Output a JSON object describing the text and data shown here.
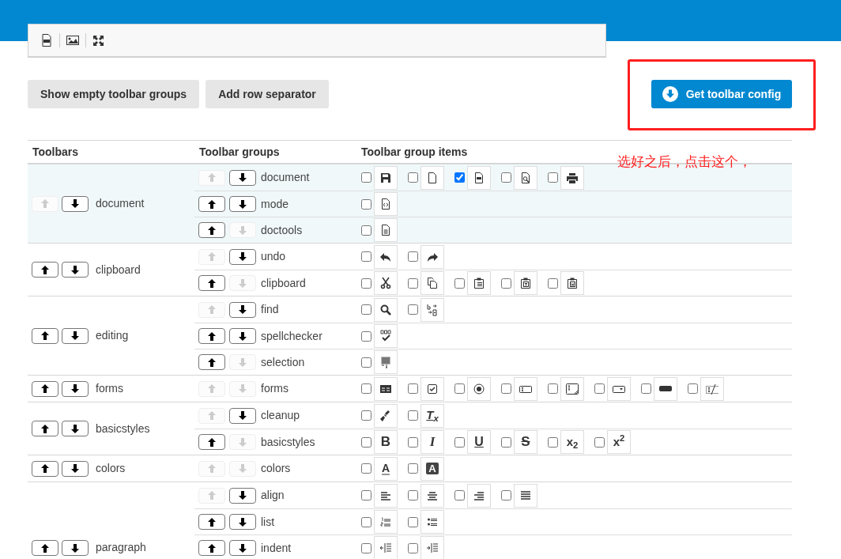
{
  "buttons": [
    "Show empty toolbar groups",
    "Add row separator"
  ],
  "config_button": "Get toolbar config",
  "annotation": "选好之后，点击这个，",
  "table": {
    "columns": [
      "Toolbars",
      "Toolbar groups",
      "Toolbar group items"
    ],
    "toolbars": [
      {
        "name": "document",
        "highlighted": true,
        "up_disabled": true,
        "down_disabled": false,
        "groups": [
          {
            "name": "document",
            "up_disabled": true,
            "down_disabled": false,
            "items": [
              {
                "kind": "save",
                "checked": false
              },
              {
                "kind": "new-page",
                "checked": false
              },
              {
                "kind": "pdf",
                "checked": true
              },
              {
                "kind": "preview",
                "checked": false
              },
              {
                "kind": "print",
                "checked": false
              }
            ]
          },
          {
            "name": "mode",
            "up_disabled": false,
            "down_disabled": false,
            "items": [
              {
                "kind": "source",
                "checked": false
              }
            ]
          },
          {
            "name": "doctools",
            "up_disabled": false,
            "down_disabled": true,
            "items": [
              {
                "kind": "templates",
                "checked": false
              }
            ]
          }
        ]
      },
      {
        "name": "clipboard",
        "highlighted": false,
        "up_disabled": false,
        "down_disabled": false,
        "groups": [
          {
            "name": "undo",
            "up_disabled": true,
            "down_disabled": false,
            "items": [
              {
                "kind": "undo",
                "checked": false
              },
              {
                "kind": "redo",
                "checked": false
              }
            ]
          },
          {
            "name": "clipboard",
            "up_disabled": false,
            "down_disabled": true,
            "items": [
              {
                "kind": "cut",
                "checked": false
              },
              {
                "kind": "copy",
                "checked": false
              },
              {
                "kind": "paste",
                "checked": false
              },
              {
                "kind": "paste-text",
                "checked": false
              },
              {
                "kind": "paste-word",
                "checked": false
              }
            ]
          }
        ]
      },
      {
        "name": "editing",
        "highlighted": false,
        "up_disabled": false,
        "down_disabled": false,
        "groups": [
          {
            "name": "find",
            "up_disabled": true,
            "down_disabled": false,
            "items": [
              {
                "kind": "find",
                "checked": false
              },
              {
                "kind": "replace",
                "checked": false
              }
            ]
          },
          {
            "name": "spellchecker",
            "up_disabled": false,
            "down_disabled": false,
            "items": [
              {
                "kind": "spellcheck",
                "checked": false
              }
            ]
          },
          {
            "name": "selection",
            "up_disabled": false,
            "down_disabled": true,
            "items": [
              {
                "kind": "select-all",
                "checked": false
              }
            ]
          }
        ]
      },
      {
        "name": "forms",
        "highlighted": false,
        "up_disabled": false,
        "down_disabled": false,
        "groups": [
          {
            "name": "forms",
            "up_disabled": true,
            "down_disabled": true,
            "items": [
              {
                "kind": "form",
                "checked": false
              },
              {
                "kind": "checkbox",
                "checked": false
              },
              {
                "kind": "radio",
                "checked": false
              },
              {
                "kind": "text-field",
                "checked": false
              },
              {
                "kind": "textarea",
                "checked": false
              },
              {
                "kind": "select",
                "checked": false
              },
              {
                "kind": "form-button",
                "checked": false
              },
              {
                "kind": "hidden-field",
                "checked": false
              }
            ]
          }
        ]
      },
      {
        "name": "basicstyles",
        "highlighted": false,
        "up_disabled": false,
        "down_disabled": false,
        "groups": [
          {
            "name": "cleanup",
            "up_disabled": true,
            "down_disabled": false,
            "items": [
              {
                "kind": "format-painter",
                "checked": false
              },
              {
                "kind": "remove-format",
                "glyph": "T$_{x}$",
                "checked": false
              }
            ]
          },
          {
            "name": "basicstyles",
            "up_disabled": false,
            "down_disabled": true,
            "items": [
              {
                "kind": "bold",
                "glyph": "B",
                "checked": false
              },
              {
                "kind": "italic",
                "glyph": "I",
                "checked": false
              },
              {
                "kind": "underline",
                "glyph": "U",
                "checked": false
              },
              {
                "kind": "strike",
                "glyph": "S",
                "checked": false
              },
              {
                "kind": "subscript",
                "glyph": "x$_{2}$",
                "checked": false
              },
              {
                "kind": "superscript",
                "glyph": "x$^{2}$",
                "checked": false
              }
            ]
          }
        ]
      },
      {
        "name": "colors",
        "highlighted": false,
        "up_disabled": false,
        "down_disabled": false,
        "groups": [
          {
            "name": "colors",
            "up_disabled": true,
            "down_disabled": true,
            "items": [
              {
                "kind": "text-color",
                "glyph": "A",
                "checked": false
              },
              {
                "kind": "background-color",
                "glyph": "A",
                "checked": false
              }
            ]
          }
        ]
      },
      {
        "name": "paragraph",
        "highlighted": false,
        "up_disabled": false,
        "down_disabled": false,
        "groups": [
          {
            "name": "align",
            "up_disabled": true,
            "down_disabled": false,
            "items": [
              {
                "kind": "align-left",
                "checked": false
              },
              {
                "kind": "align-center",
                "checked": false
              },
              {
                "kind": "align-right",
                "checked": false
              },
              {
                "kind": "justify",
                "checked": false
              }
            ]
          },
          {
            "name": "list",
            "up_disabled": false,
            "down_disabled": false,
            "items": [
              {
                "kind": "numbered-list",
                "checked": false
              },
              {
                "kind": "bulleted-list",
                "checked": false
              }
            ]
          },
          {
            "name": "indent",
            "up_disabled": false,
            "down_disabled": false,
            "items": [
              {
                "kind": "outdent",
                "checked": false
              },
              {
                "kind": "indent",
                "checked": false
              }
            ]
          }
        ]
      }
    ]
  }
}
